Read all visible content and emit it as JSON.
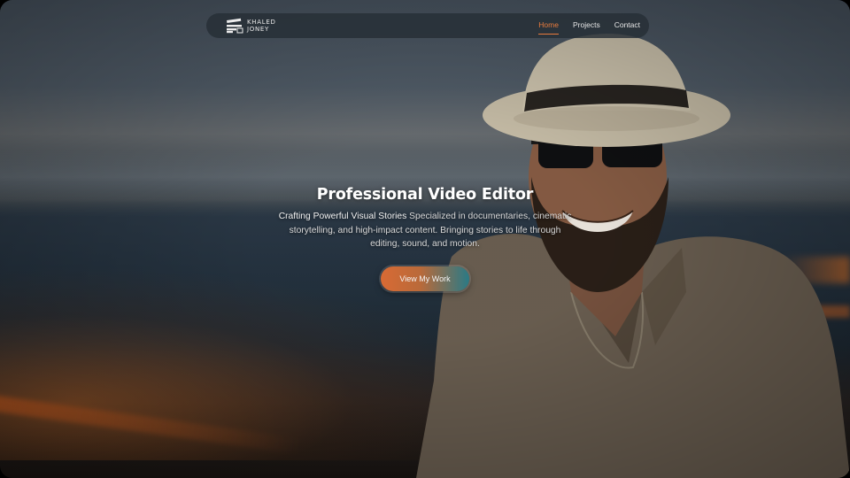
{
  "brand": {
    "line1": "KHALED",
    "line2": "JONEY"
  },
  "nav": {
    "items": [
      {
        "label": "Home",
        "active": true
      },
      {
        "label": "Projects",
        "active": false
      },
      {
        "label": "Contact",
        "active": false
      }
    ],
    "accent_color": "#e87b3c"
  },
  "hero": {
    "title": "Professional Video Editor",
    "description_lead": "Crafting Powerful Visual Stories",
    "description_rest": " Specialized in documentaries, cinematic storytelling, and high-impact content. Bringing stories to life through editing, sound, and motion.",
    "cta_label": "View My Work"
  }
}
